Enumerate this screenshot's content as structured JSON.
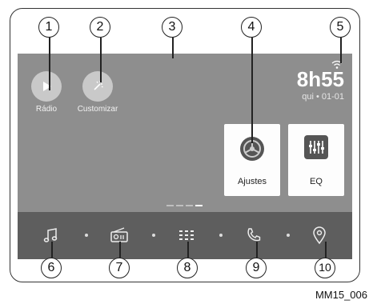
{
  "apps": [
    {
      "label": "Rádio",
      "icon": "play-icon"
    },
    {
      "label": "Customizar",
      "icon": "magic-wand-icon"
    }
  ],
  "clock": {
    "time": "8h55",
    "date": "qui • 01-01"
  },
  "tiles": [
    {
      "label": "Ajustes",
      "icon": "settings-gear-icon"
    },
    {
      "label": "EQ",
      "icon": "equalizer-icon"
    }
  ],
  "page_indicator": {
    "pages": 4,
    "current": 4
  },
  "dock": [
    "music-note-icon",
    "radio-icon",
    "app-grid-icon",
    "phone-icon",
    "location-pin-icon"
  ],
  "callouts": [
    "1",
    "2",
    "3",
    "4",
    "5",
    "6",
    "7",
    "8",
    "9",
    "10"
  ],
  "caption": "MM15_006"
}
